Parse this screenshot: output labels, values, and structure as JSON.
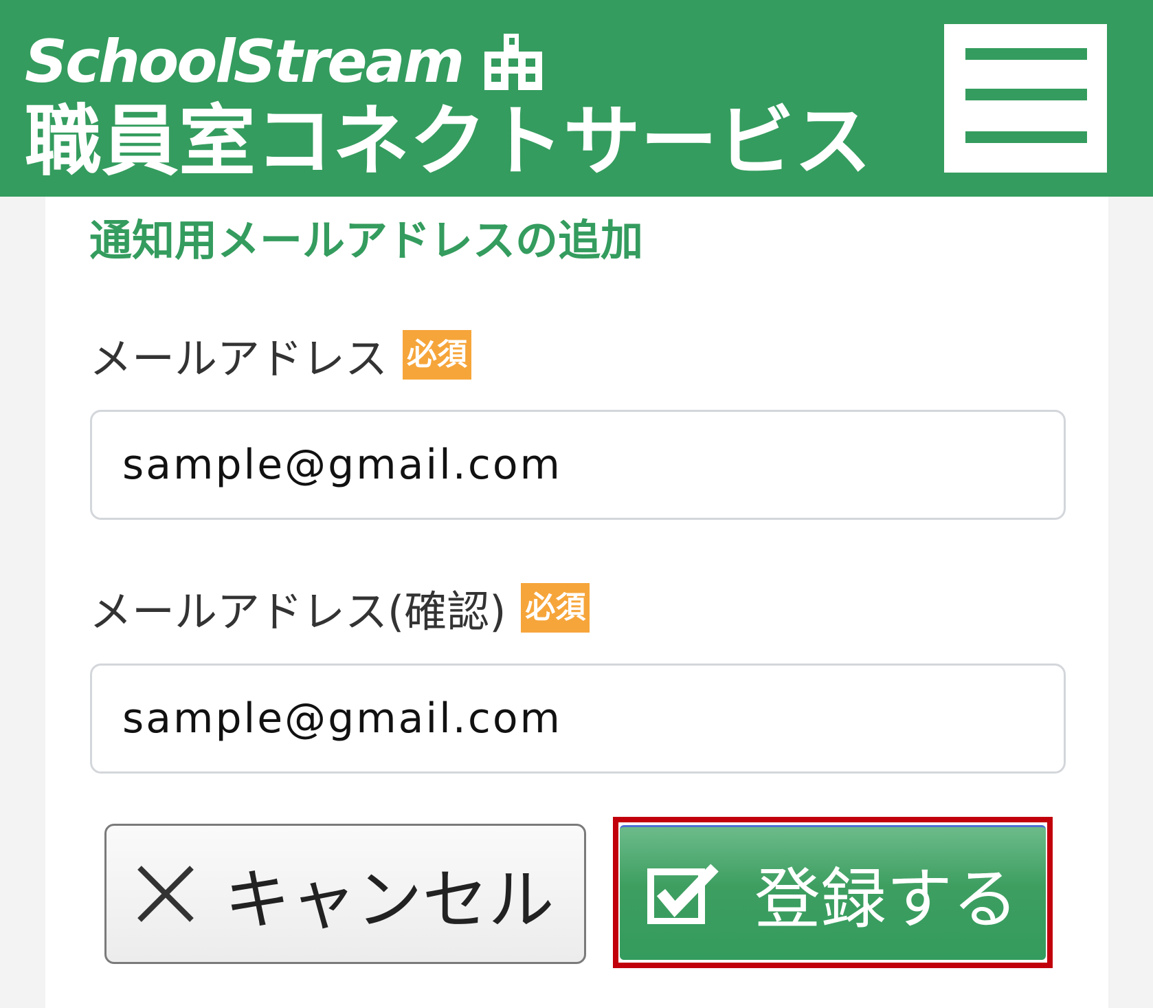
{
  "header": {
    "brand": "SchoolStream",
    "service_name": "職員室コネクトサービス",
    "menu_icon": "hamburger-menu-icon",
    "school_icon": "school-building-icon",
    "background_color": "#349c5e"
  },
  "form": {
    "title": "通知用メールアドレスの追加",
    "email": {
      "label": "メールアドレス",
      "required_badge": "必須",
      "value": "sample@gmail.com"
    },
    "email_confirm": {
      "label": "メールアドレス(確認)",
      "required_badge": "必須",
      "value": "sample@gmail.com"
    }
  },
  "buttons": {
    "cancel": {
      "label": "キャンセル",
      "icon": "close-x-icon"
    },
    "register": {
      "label": "登録する",
      "icon": "checkbox-check-icon",
      "highlight_color": "#c1000c"
    }
  },
  "colors": {
    "accent_green": "#349c5e",
    "required_badge": "#f6a53a"
  }
}
